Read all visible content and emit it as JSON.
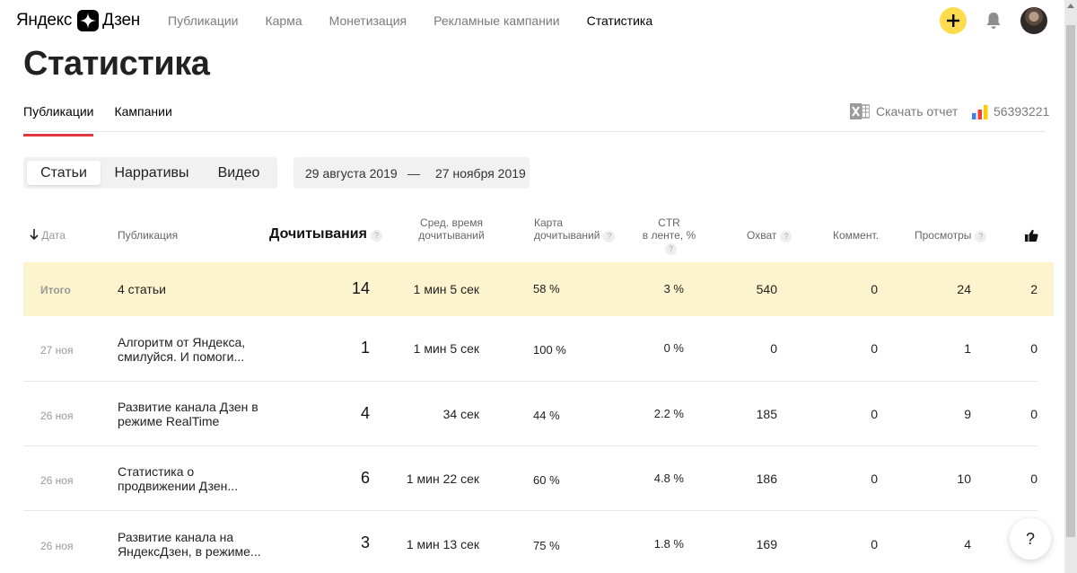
{
  "logo": {
    "text_left": "Яндекс",
    "text_right": "Дзен"
  },
  "nav": [
    "Публикации",
    "Карма",
    "Монетизация",
    "Рекламные кампании",
    "Статистика"
  ],
  "page_title": "Статистика",
  "tabs": [
    "Публикации",
    "Кампании"
  ],
  "download_label": "Скачать отчет",
  "counter_id": "56393221",
  "segments": [
    "Статьи",
    "Нарративы",
    "Видео"
  ],
  "date_from": "29 августа 2019",
  "date_sep": "—",
  "date_to": "27 ноября 2019",
  "columns": {
    "date": "Дата",
    "publication": "Публикация",
    "reads": "Дочитывания",
    "avg_time_1": "Сред. время",
    "avg_time_2": "дочитываний",
    "map_1": "Карта",
    "map_2": "дочитываний",
    "ctr_1": "CTR",
    "ctr_2": "в ленте, %",
    "reach": "Охват",
    "comments": "Коммент.",
    "views": "Просмотры"
  },
  "help_mark": "?",
  "rows": [
    {
      "date": "Итого",
      "title": [
        "4 статьи",
        ""
      ],
      "reads": "14",
      "time": "1 мин 5 сек",
      "map": "58 %",
      "ctr": "3 %",
      "reach": "540",
      "comments": "0",
      "views": "24",
      "likes": "2"
    },
    {
      "date": "27 ноя",
      "title": [
        "Алгоритм от Яндекса,",
        "смилуйся. И помоги..."
      ],
      "reads": "1",
      "time": "1 мин 5 сек",
      "map": "100 %",
      "ctr": "0 %",
      "reach": "0",
      "comments": "0",
      "views": "1",
      "likes": "0"
    },
    {
      "date": "26 ноя",
      "title": [
        "Развитие канала Дзен в",
        "режиме RealTime"
      ],
      "reads": "4",
      "time": "34 сек",
      "map": "44 %",
      "ctr": "2.2 %",
      "reach": "185",
      "comments": "0",
      "views": "9",
      "likes": "0"
    },
    {
      "date": "26 ноя",
      "title": [
        "Статистика о",
        "продвижении Дзен..."
      ],
      "reads": "6",
      "time": "1 мин 22 сек",
      "map": "60 %",
      "ctr": "4.8 %",
      "reach": "186",
      "comments": "0",
      "views": "10",
      "likes": "0"
    },
    {
      "date": "26 ноя",
      "title": [
        "Развитие канала на",
        "ЯндексДзен, в режиме..."
      ],
      "reads": "3",
      "time": "1 мин 13 сек",
      "map": "75 %",
      "ctr": "1.8 %",
      "reach": "169",
      "comments": "0",
      "views": "4",
      "likes": ""
    }
  ],
  "colors": {
    "accent_yellow": "#ffdb4d",
    "tab_underline": "#e2373f",
    "total_row": "#fcf4ce"
  }
}
